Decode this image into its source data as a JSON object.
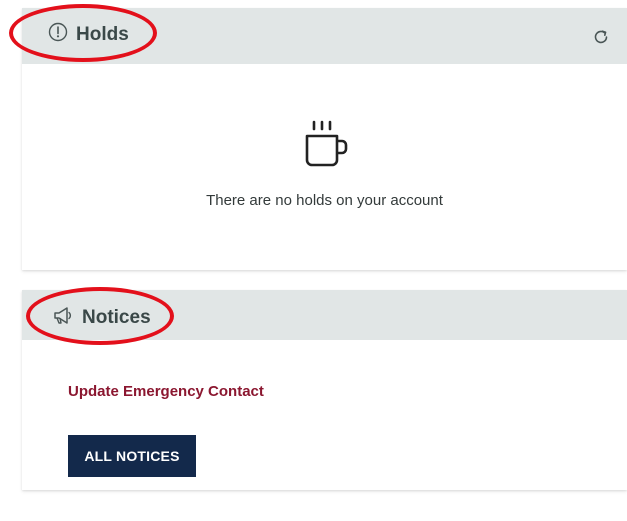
{
  "holds": {
    "title": "Holds",
    "icon": "exclamation-circle-icon",
    "refresh_icon": "refresh-icon",
    "empty_icon": "coffee-mug-icon",
    "empty_message": "There are no holds on your account"
  },
  "notices": {
    "title": "Notices",
    "icon": "megaphone-icon",
    "items": [
      {
        "label": "Update Emergency Contact"
      }
    ],
    "all_button_label": "ALL NOTICES"
  },
  "colors": {
    "header_bg": "#e1e6e6",
    "title_text": "#3a4848",
    "link": "#8b1730",
    "button_bg": "#13294b",
    "annotation": "#e3101b"
  }
}
